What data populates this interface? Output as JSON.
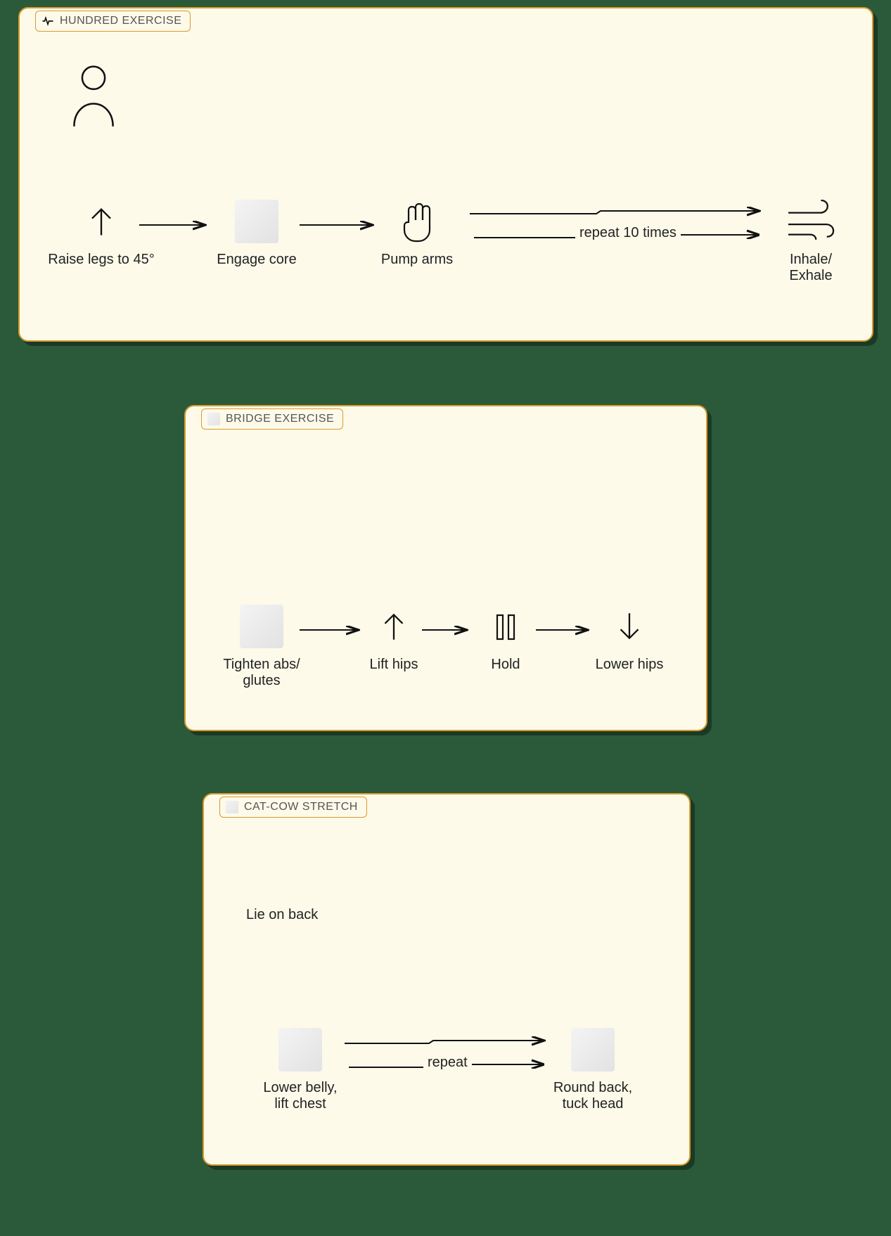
{
  "cards": {
    "hundred": {
      "title": "HUNDRED EXERCISE",
      "title_icon": "pulse-icon",
      "person_icon": "person-icon",
      "steps": [
        {
          "label": "Raise legs to 45°",
          "icon": "arrow-up"
        },
        {
          "label": "Engage core",
          "icon": "placeholder"
        },
        {
          "label": "Pump arms",
          "icon": "hand"
        },
        {
          "label": "Inhale/\nExhale",
          "icon": "wind"
        }
      ],
      "repeat_label": "repeat 10 times"
    },
    "bridge": {
      "title": "BRIDGE EXERCISE",
      "title_icon": "placeholder",
      "steps": [
        {
          "label": "Tighten abs/\nglutes",
          "icon": "placeholder"
        },
        {
          "label": "Lift hips",
          "icon": "arrow-up"
        },
        {
          "label": "Hold",
          "icon": "pause"
        },
        {
          "label": "Lower hips",
          "icon": "arrow-down"
        }
      ]
    },
    "catcow": {
      "title": "CAT-COW STRETCH",
      "title_icon": "placeholder",
      "note": "Lie on back",
      "steps": [
        {
          "label": "Lower belly,\nlift chest",
          "icon": "placeholder"
        },
        {
          "label": "Round back,\ntuck head",
          "icon": "placeholder"
        }
      ],
      "repeat_label": "repeat"
    }
  }
}
